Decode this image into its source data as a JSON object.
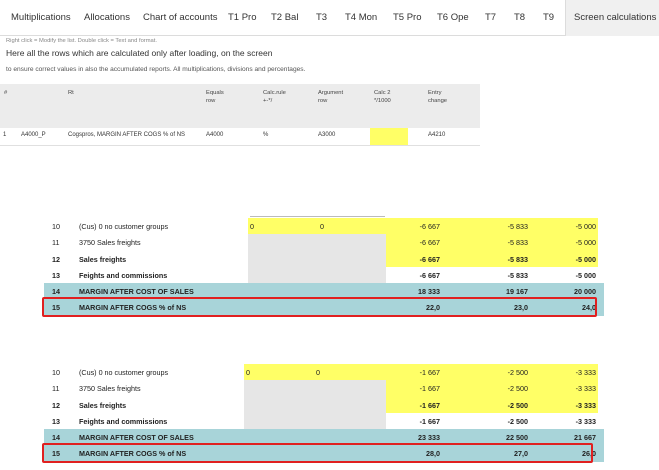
{
  "tabs": [
    "Multiplications",
    "Allocations",
    "Chart of accounts",
    "T1 Pro",
    "T2 Bal",
    "T3",
    "T4 Mon",
    "T5 Pro",
    "T6 Ope",
    "T7",
    "T8",
    "T9",
    "Screen calculations"
  ],
  "hint": "Right click = Modify the list. Double click = Text and format.",
  "intro_line1": "Here all the rows which are calculated only after loading, on the screen",
  "intro_line2": "to ensure correct values in also the accumulated reports. All multiplications, divisions and percentages.",
  "grid": {
    "headers": {
      "hash": "#",
      "rt": "Rt",
      "equals": "Equals\nrow",
      "calcrule": "Calc.rule\n+-*/",
      "argument": "Argument\nrow",
      "calc2": "Calc 2\n*/1000",
      "entry": "Entry\nchange"
    },
    "row": {
      "num": "1",
      "code": "A4000_P",
      "rt": "Cogspros, MARGIN AFTER COGS % of NS",
      "equals": "A4000",
      "calcrule": "%",
      "argument": "A3000",
      "calc2": "",
      "entry": "A4210"
    }
  },
  "table1": {
    "rows": [
      {
        "num": "10",
        "label": "(Cus) 0 no customer groups",
        "c1": "0",
        "c2": "0",
        "v1": "-6 667",
        "v2": "-5 833",
        "v3": "-5 000"
      },
      {
        "num": "11",
        "label": "3750 Sales freights",
        "v1": "-6 667",
        "v2": "-5 833",
        "v3": "-5 000"
      },
      {
        "num": "12",
        "label": "Sales freights",
        "v1": "-6 667",
        "v2": "-5 833",
        "v3": "-5 000"
      },
      {
        "num": "13",
        "label": "Feights and commissions",
        "v1": "-6 667",
        "v2": "-5 833",
        "v3": "-5 000"
      },
      {
        "num": "14",
        "label": "MARGIN AFTER COST OF SALES",
        "v1": "18 333",
        "v2": "19 167",
        "v3": "20 000"
      },
      {
        "num": "15",
        "label": "MARGIN AFTER COGS % of NS",
        "v1": "22,0",
        "v2": "23,0",
        "v3": "24,0"
      }
    ]
  },
  "table2": {
    "rows": [
      {
        "num": "10",
        "label": "(Cus) 0 no customer groups",
        "c1": "0",
        "c2": "0",
        "v1": "-1 667",
        "v2": "-2 500",
        "v3": "-3 333"
      },
      {
        "num": "11",
        "label": "3750 Sales freights",
        "v1": "-1 667",
        "v2": "-2 500",
        "v3": "-3 333"
      },
      {
        "num": "12",
        "label": "Sales freights",
        "v1": "-1 667",
        "v2": "-2 500",
        "v3": "-3 333"
      },
      {
        "num": "13",
        "label": "Feights and commissions",
        "v1": "-1 667",
        "v2": "-2 500",
        "v3": "-3 333"
      },
      {
        "num": "14",
        "label": "MARGIN AFTER COST OF SALES",
        "v1": "23 333",
        "v2": "22 500",
        "v3": "21 667"
      },
      {
        "num": "15",
        "label": "MARGIN AFTER COGS % of NS",
        "v1": "28,0",
        "v2": "27,0",
        "v3": "26,0"
      }
    ]
  },
  "colors": {
    "yellow": "#ffff66",
    "teal": "#a8d4d9",
    "highlight": "#e02020"
  }
}
